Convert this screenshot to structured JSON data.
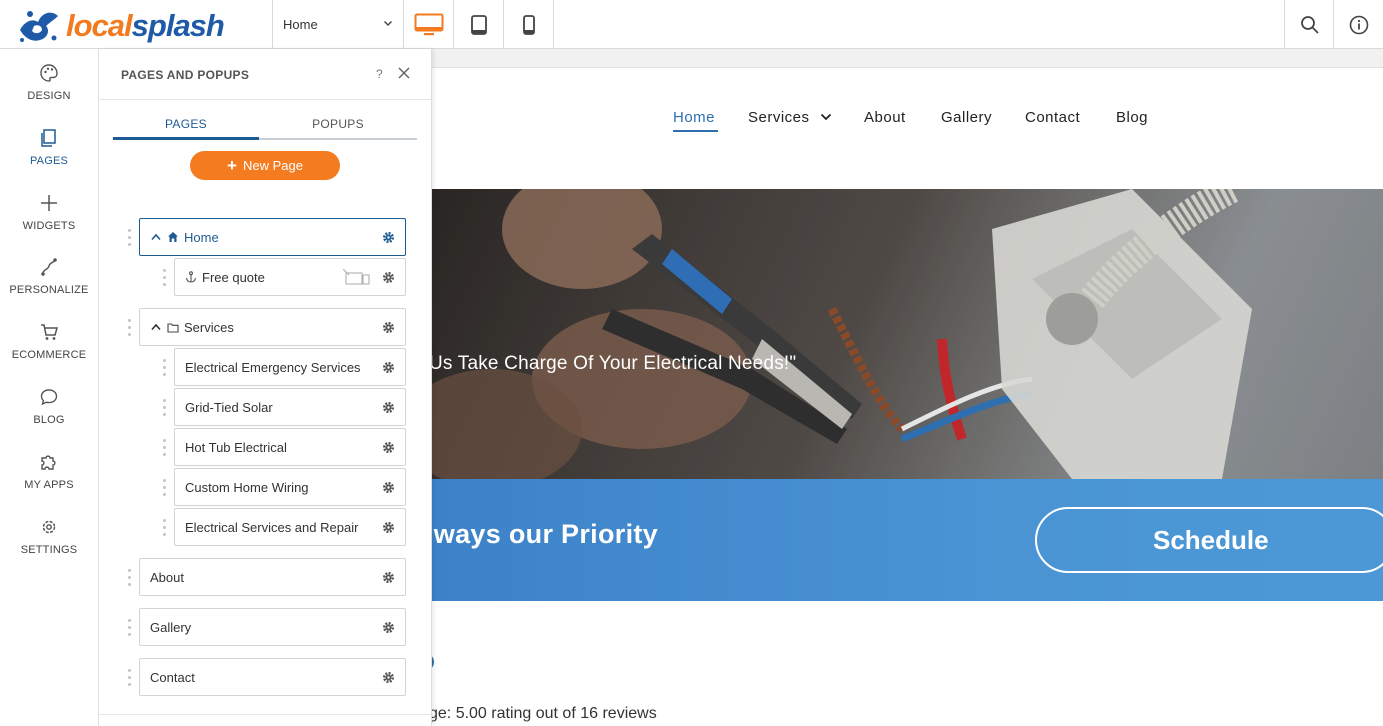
{
  "brand": {
    "logo_left": "local",
    "logo_right": "splash",
    "accent": "#f47b20",
    "primary": "#1f5b93"
  },
  "toolbar": {
    "page_select": "Home",
    "devices": [
      "desktop-icon",
      "tablet-icon",
      "mobile-icon"
    ],
    "active_device": "desktop",
    "right_icons": [
      "search-icon",
      "info-icon"
    ]
  },
  "rail": {
    "items": [
      {
        "label": "DESIGN",
        "icon": "palette-icon"
      },
      {
        "label": "PAGES",
        "icon": "pages-icon",
        "active": true
      },
      {
        "label": "WIDGETS",
        "icon": "plus-icon"
      },
      {
        "label": "PERSONALIZE",
        "icon": "personalize-icon"
      },
      {
        "label": "ECOMMERCE",
        "icon": "cart-icon"
      },
      {
        "label": "BLOG",
        "icon": "chat-icon"
      },
      {
        "label": "MY APPS",
        "icon": "puzzle-icon"
      },
      {
        "label": "SETTINGS",
        "icon": "gear-icon"
      }
    ]
  },
  "panel": {
    "title": "PAGES AND POPUPS",
    "help": "?",
    "tabs": [
      {
        "label": "PAGES",
        "active": true
      },
      {
        "label": "POPUPS",
        "active": false
      }
    ],
    "new_page_label": "New Page",
    "pages": [
      {
        "name": "Home",
        "level": 0,
        "selected": true,
        "expanded": true,
        "icon": "home-icon"
      },
      {
        "name": "Free quote",
        "level": 1,
        "icon": "anchor-icon",
        "hidden_devices": true
      },
      {
        "name": "Services",
        "level": 0,
        "expanded": true,
        "icon": "folder-icon"
      },
      {
        "name": "Electrical Emergency Services",
        "level": 1
      },
      {
        "name": "Grid-Tied Solar",
        "level": 1
      },
      {
        "name": "Hot Tub Electrical",
        "level": 1
      },
      {
        "name": "Custom Home Wiring",
        "level": 1
      },
      {
        "name": "Electrical Services and Repair",
        "level": 1
      },
      {
        "name": "About",
        "level": 0
      },
      {
        "name": "Gallery",
        "level": 0
      },
      {
        "name": "Contact",
        "level": 0
      }
    ]
  },
  "site": {
    "nav": [
      "Home",
      "Services",
      "About",
      "Gallery",
      "Contact",
      "Blog"
    ],
    "active_nav": "Home",
    "hero_text": "Us Take Charge Of Your Electrical Needs!\"",
    "band_text": "lways our Priority",
    "schedule_label": "Schedule",
    "rating_text": "ge: 5.00 rating out of 16 reviews"
  }
}
